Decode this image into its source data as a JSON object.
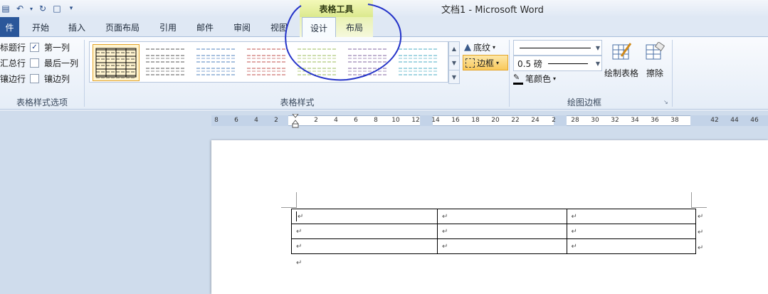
{
  "title_bar": {
    "document_title": "文档1 - Microsoft Word",
    "context_header": "表格工具",
    "qat_icons": [
      "save-icon",
      "undo-icon",
      "redo-icon",
      "new-document-icon",
      "customize-qat-icon"
    ]
  },
  "tabs": [
    {
      "label": "件",
      "kind": "file"
    },
    {
      "label": "开始"
    },
    {
      "label": "插入"
    },
    {
      "label": "页面布局"
    },
    {
      "label": "引用"
    },
    {
      "label": "邮件"
    },
    {
      "label": "审阅"
    },
    {
      "label": "视图"
    },
    {
      "label": "设计",
      "active": true
    },
    {
      "label": "布局"
    }
  ],
  "ribbon": {
    "style_options": {
      "label": "表格样式选项",
      "items": [
        {
          "label": "标题行",
          "checked": true
        },
        {
          "label": "汇总行",
          "checked": false
        },
        {
          "label": "镶边行",
          "checked": true
        },
        {
          "label": "第一列",
          "checked": true
        },
        {
          "label": "最后一列",
          "checked": false
        },
        {
          "label": "镶边列",
          "checked": false
        }
      ],
      "visible_left_labels": [
        "标题行",
        "汇总行",
        "镶边行"
      ],
      "visible_right_labels": [
        "第一列",
        "最后一列",
        "镶边列"
      ]
    },
    "table_styles": {
      "label": "表格样式",
      "swatch_colors": [
        "#000000",
        "#555555",
        "#4f81bd",
        "#c0504d",
        "#9bbb59",
        "#8064a2",
        "#4bacc6"
      ],
      "shading_label": "底纹",
      "borders_label": "边框"
    },
    "draw_borders": {
      "label": "绘图边框",
      "line_weight": "0.5 磅",
      "pen_color_label": "笔颜色",
      "draw_table_label": "绘制表格",
      "eraser_label": "擦除"
    }
  },
  "ruler": {
    "labels": [
      "8",
      "6",
      "4",
      "2",
      "2",
      "4",
      "6",
      "8",
      "10",
      "12",
      "14",
      "16",
      "18",
      "20",
      "22",
      "24",
      "2",
      "28",
      "30",
      "32",
      "34",
      "36",
      "38",
      "42",
      "44",
      "46"
    ]
  },
  "document": {
    "table": {
      "rows": 3,
      "cols": 3
    },
    "paragraph_mark": "↵"
  },
  "annotation": {
    "color": "#2433c8",
    "target": "设计"
  }
}
